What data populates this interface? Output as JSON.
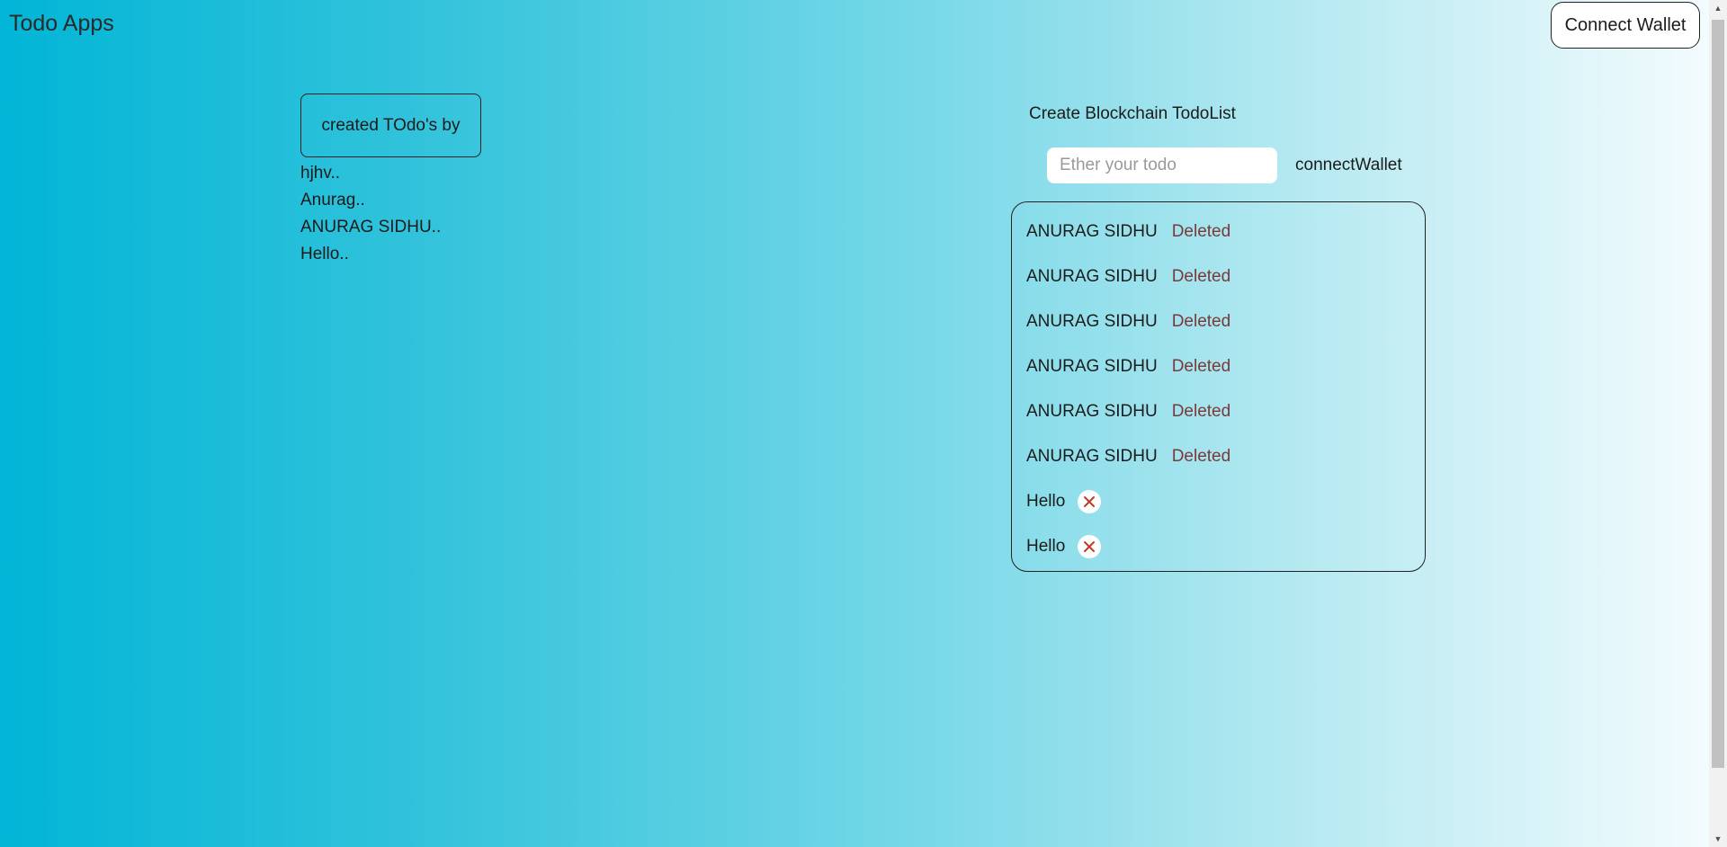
{
  "header": {
    "title": "Todo Apps",
    "connect_wallet_label": "Connect Wallet"
  },
  "created_by": {
    "label": "created TOdo's by",
    "items": [
      "hjhv..",
      "Anurag..",
      "ANURAG SIDHU..",
      "Hello.."
    ]
  },
  "create_form": {
    "heading": "Create Blockchain TodoList",
    "input_placeholder": "Ether your todo",
    "input_value": "",
    "connect_link": "connectWallet"
  },
  "todos": [
    {
      "text": "ANURAG SIDHU",
      "status": "Deleted"
    },
    {
      "text": "ANURAG SIDHU",
      "status": "Deleted"
    },
    {
      "text": "ANURAG SIDHU",
      "status": "Deleted"
    },
    {
      "text": "ANURAG SIDHU",
      "status": "Deleted"
    },
    {
      "text": "ANURAG SIDHU",
      "status": "Deleted"
    },
    {
      "text": "ANURAG SIDHU",
      "status": "Deleted"
    },
    {
      "text": "Hello",
      "status": "",
      "action_icon": "close-icon"
    },
    {
      "text": "Hello",
      "status": "",
      "action_icon": "close-icon"
    }
  ],
  "colors": {
    "gradient_start": "#02b5d6",
    "gradient_end": "#f3fbfd",
    "deleted_text": "#7a3a3a",
    "delete_icon": "#c0392b"
  }
}
